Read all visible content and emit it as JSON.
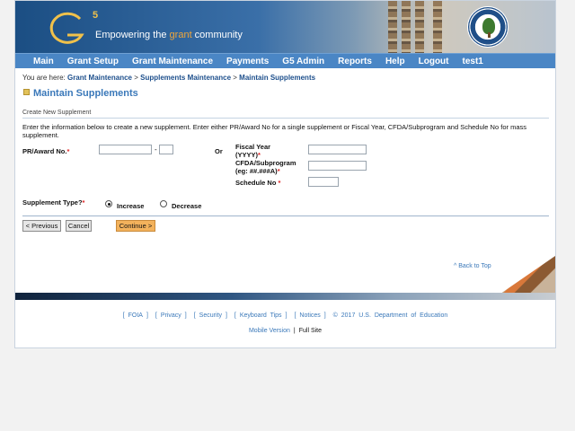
{
  "banner": {
    "logo_letter": "G",
    "logo_number": "5",
    "tagline_pre": "Empowering the ",
    "tagline_accent": "grant",
    "tagline_post": " community"
  },
  "nav": {
    "items": [
      "Main",
      "Grant Setup",
      "Grant Maintenance",
      "Payments",
      "G5 Admin",
      "Reports",
      "Help",
      "Logout",
      "test1"
    ]
  },
  "breadcrumb": {
    "prefix": "You are here: ",
    "items": [
      "Grant Maintenance",
      "Supplements Maintenance",
      "Maintain Supplements"
    ],
    "separator": " > "
  },
  "page": {
    "title": "Maintain Supplements",
    "section_label": "Create New Supplement",
    "instructions": "Enter the information below to create a new supplement. Enter either PR/Award No for a single supplement or Fiscal Year, CFDA/Subprogram and Schedule No for mass supplement."
  },
  "form": {
    "pr_label": "PR/Award No.",
    "pr_value": "",
    "pr_dash": "-",
    "pr_suffix_value": "",
    "or_label": "Or",
    "fy_label_1": "Fiscal Year",
    "fy_label_2": "(YYYY)",
    "fy_value": "",
    "cfda_label_1": "CFDA/Subprogram",
    "cfda_label_2": "(eg: ##.###A)",
    "cfda_value": "",
    "sched_label": "Schedule No",
    "sched_value": "",
    "required_mark": "*",
    "type_label": "Supplement Type?",
    "increase_label": "Increase",
    "decrease_label": "Decrease",
    "selected_type": "Increase"
  },
  "buttons": {
    "previous": "< Previous",
    "cancel": "Cancel",
    "continue": "Continue >"
  },
  "back_to_top": "^ Back to Top",
  "footer": {
    "links": [
      "FOIA",
      "Privacy",
      "Security",
      "Keyboard Tips",
      "Notices"
    ],
    "copyright": "© 2017 U.S. Department of Education",
    "mobile": "Mobile Version",
    "separator": "|",
    "full_site": "Full Site"
  },
  "colors": {
    "nav_bg": "#4a86c5",
    "title": "#3a78b9",
    "link": "#1d4f8c",
    "continue_btn": "#f3b25c",
    "required": "#dd2222"
  }
}
